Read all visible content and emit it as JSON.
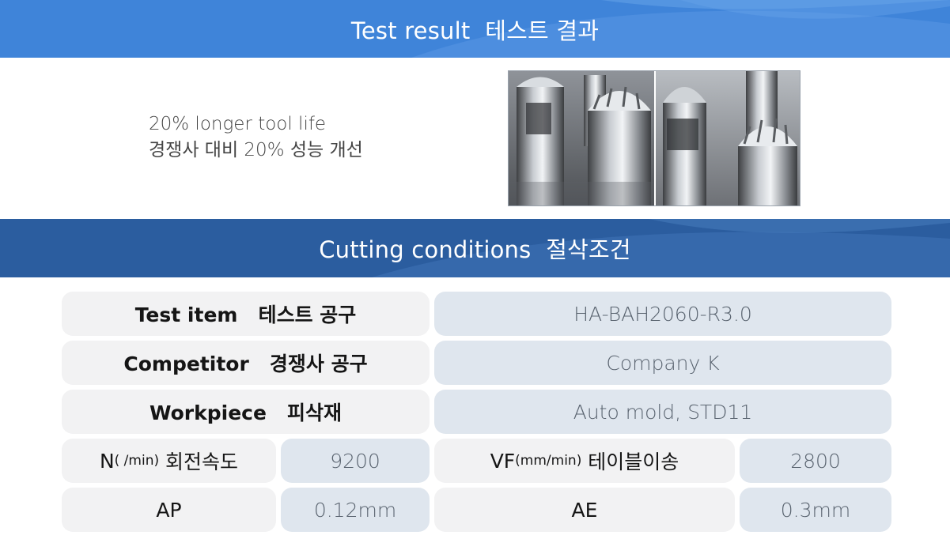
{
  "banners": {
    "test_result": "Test result  테스트 결과",
    "cutting_conditions": "Cutting conditions  절삭조건"
  },
  "summary": {
    "line1": "20% longer tool life",
    "line2": "경쟁사 대비 20% 성능 개선"
  },
  "photo": {
    "alt": "Comparison photo of worn cutting tools"
  },
  "conditions": {
    "test_item": {
      "label": "Test item   테스트 공구",
      "value": "HA-BAH2060-R3.0"
    },
    "competitor": {
      "label": "Competitor   경쟁사 공구",
      "value": "Company K"
    },
    "workpiece": {
      "label": "Workpiece   피삭재",
      "value": "Auto mold, STD11"
    },
    "n": {
      "label_main": "N",
      "label_unit": "( /min)",
      "label_kr": " 회전속도",
      "value": "9200"
    },
    "vf": {
      "label_main": "VF",
      "label_unit": "(mm/min)",
      "label_kr": " 테이블이송",
      "value": "2800"
    },
    "ap": {
      "label": "AP",
      "value": "0.12mm"
    },
    "ae": {
      "label": "AE",
      "value": "0.3mm"
    }
  },
  "colors": {
    "banner_top": "#3f84d9",
    "banner_bottom": "#2b5d9f",
    "label_bg": "#f2f2f3",
    "value_bg": "#dfe6ee"
  }
}
